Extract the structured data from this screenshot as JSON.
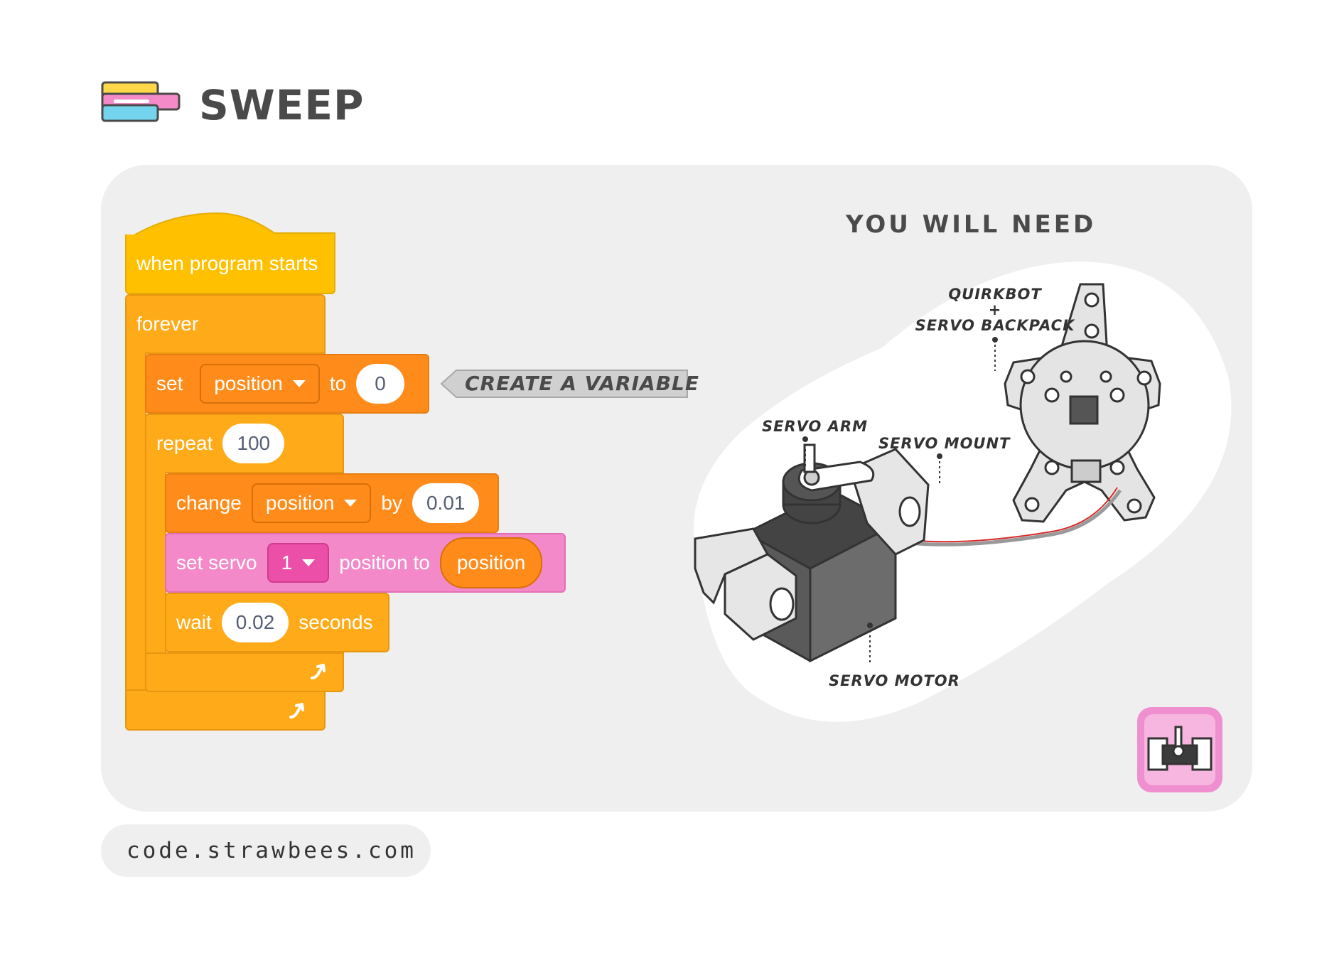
{
  "header": {
    "title": "SWEEP",
    "logo_icon": "stacked-blocks-icon"
  },
  "blocks": {
    "hat": "when program starts",
    "forever": "forever",
    "set": {
      "label": "set",
      "variable": "position",
      "to": "to",
      "value": "0"
    },
    "repeat": {
      "label": "repeat",
      "count": "100"
    },
    "change": {
      "label": "change",
      "variable": "position",
      "by": "by",
      "value": "0.01"
    },
    "servo": {
      "label": "set servo",
      "servo": "1",
      "position_to": "position to",
      "reporter": "position"
    },
    "wait": {
      "label": "wait",
      "value": "0.02",
      "seconds": "seconds"
    },
    "loop_icon": "loop-arrow-icon"
  },
  "callout": {
    "text": "CREATE A VARIABLE"
  },
  "needs": {
    "title": "YOU WILL NEED",
    "labels": {
      "quirkbot_line1": "QUIRKBOT",
      "quirkbot_plus": "+",
      "quirkbot_line2": "SERVO BACKPACK",
      "servo_arm": "SERVO ARM",
      "servo_mount": "SERVO MOUNT",
      "servo_motor": "SERVO MOTOR"
    }
  },
  "badge_icon": "servo-icon",
  "footer": {
    "url": "code.strawbees.com"
  },
  "colors": {
    "control": "#ffab19",
    "variables": "#ff8c1a",
    "servo": "#f389c8",
    "events": "#ffc000",
    "panel": "#efefef",
    "badge": "#f08fd0"
  }
}
